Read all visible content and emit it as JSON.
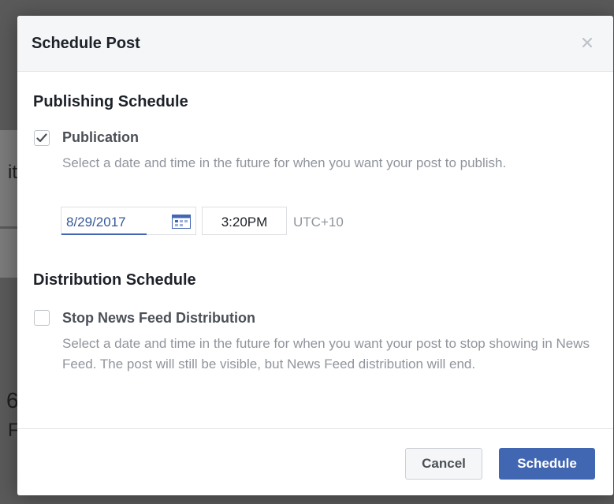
{
  "background": {
    "fragment_1": "it",
    "fragment_2": "6",
    "fragment_3": "F"
  },
  "modal": {
    "title": "Schedule Post",
    "close_icon": "close-icon"
  },
  "publishing": {
    "heading": "Publishing Schedule",
    "checkbox_checked": true,
    "label": "Publication",
    "description": "Select a date and time in the future for when you want your post to publish.",
    "date": "8/29/2017",
    "time": "3:20PM",
    "timezone": "UTC+10"
  },
  "distribution": {
    "heading": "Distribution Schedule",
    "checkbox_checked": false,
    "label": "Stop News Feed Distribution",
    "description": "Select a date and time in the future for when you want your post to stop showing in News Feed. The post will still be visible, but News Feed distribution will end."
  },
  "footer": {
    "cancel_label": "Cancel",
    "schedule_label": "Schedule"
  },
  "colors": {
    "accent": "#4267b2",
    "date_text": "#365899",
    "muted_text": "#90949c"
  }
}
